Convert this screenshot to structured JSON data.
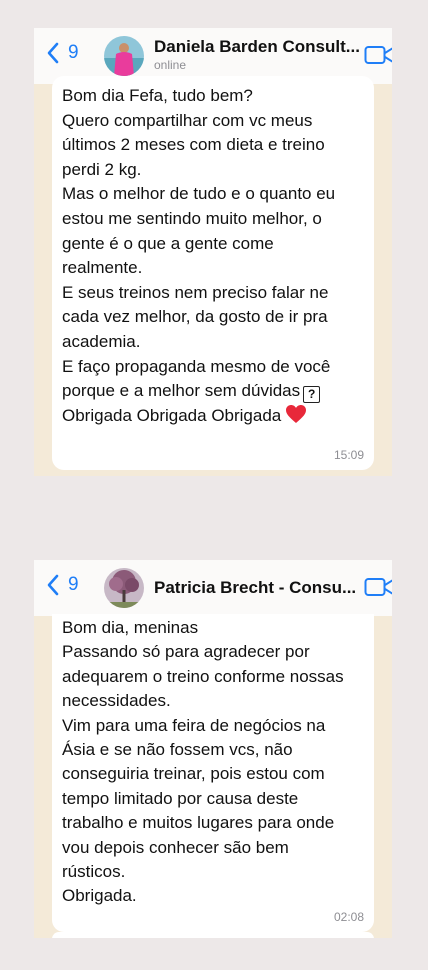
{
  "chats": [
    {
      "back_count": "9",
      "contact_name": "Daniela Barden Consult...",
      "status": "online",
      "message_lines": [
        "Bom dia Fefa, tudo bem?",
        "Quero compartilhar com vc meus",
        "últimos 2 meses com dieta e treino",
        "perdi 2 kg.",
        "Mas o melhor de tudo e o quanto eu",
        "estou me sentindo muito melhor, o",
        "gente é o que a gente come",
        "realmente.",
        "E seus treinos nem preciso falar ne",
        "cada vez melhor, da gosto de ir pra",
        "academia.",
        "E faço propaganda mesmo de você",
        "porque e a melhor sem dúvidas",
        "Obrigada Obrigada Obrigada"
      ],
      "unknown_glyph": "?",
      "time": "15:09"
    },
    {
      "back_count": "9",
      "contact_name": "Patricia Brecht - Consu...",
      "status": "",
      "message_lines": [
        "Bom dia, meninas",
        "Passando só para agradecer por",
        "adequarem o treino conforme nossas",
        "necessidades.",
        "Vim para uma feira de negócios na",
        "Ásia e se não fossem vcs, não",
        "conseguiria treinar, pois estou com",
        "tempo limitado por causa deste",
        "trabalho e muitos lugares para onde",
        "vou depois conhecer são bem",
        "rústicos.",
        "Obrigada."
      ],
      "time": "02:08"
    }
  ],
  "colors": {
    "accent": "#1f7ef7",
    "page_bg": "#ede8e8",
    "chat_bg": "#f4ead8",
    "heart": "#e8283a"
  },
  "icons": [
    "chevron-left-icon",
    "video-call-icon",
    "heart-emoji",
    "question-box-glyph"
  ]
}
